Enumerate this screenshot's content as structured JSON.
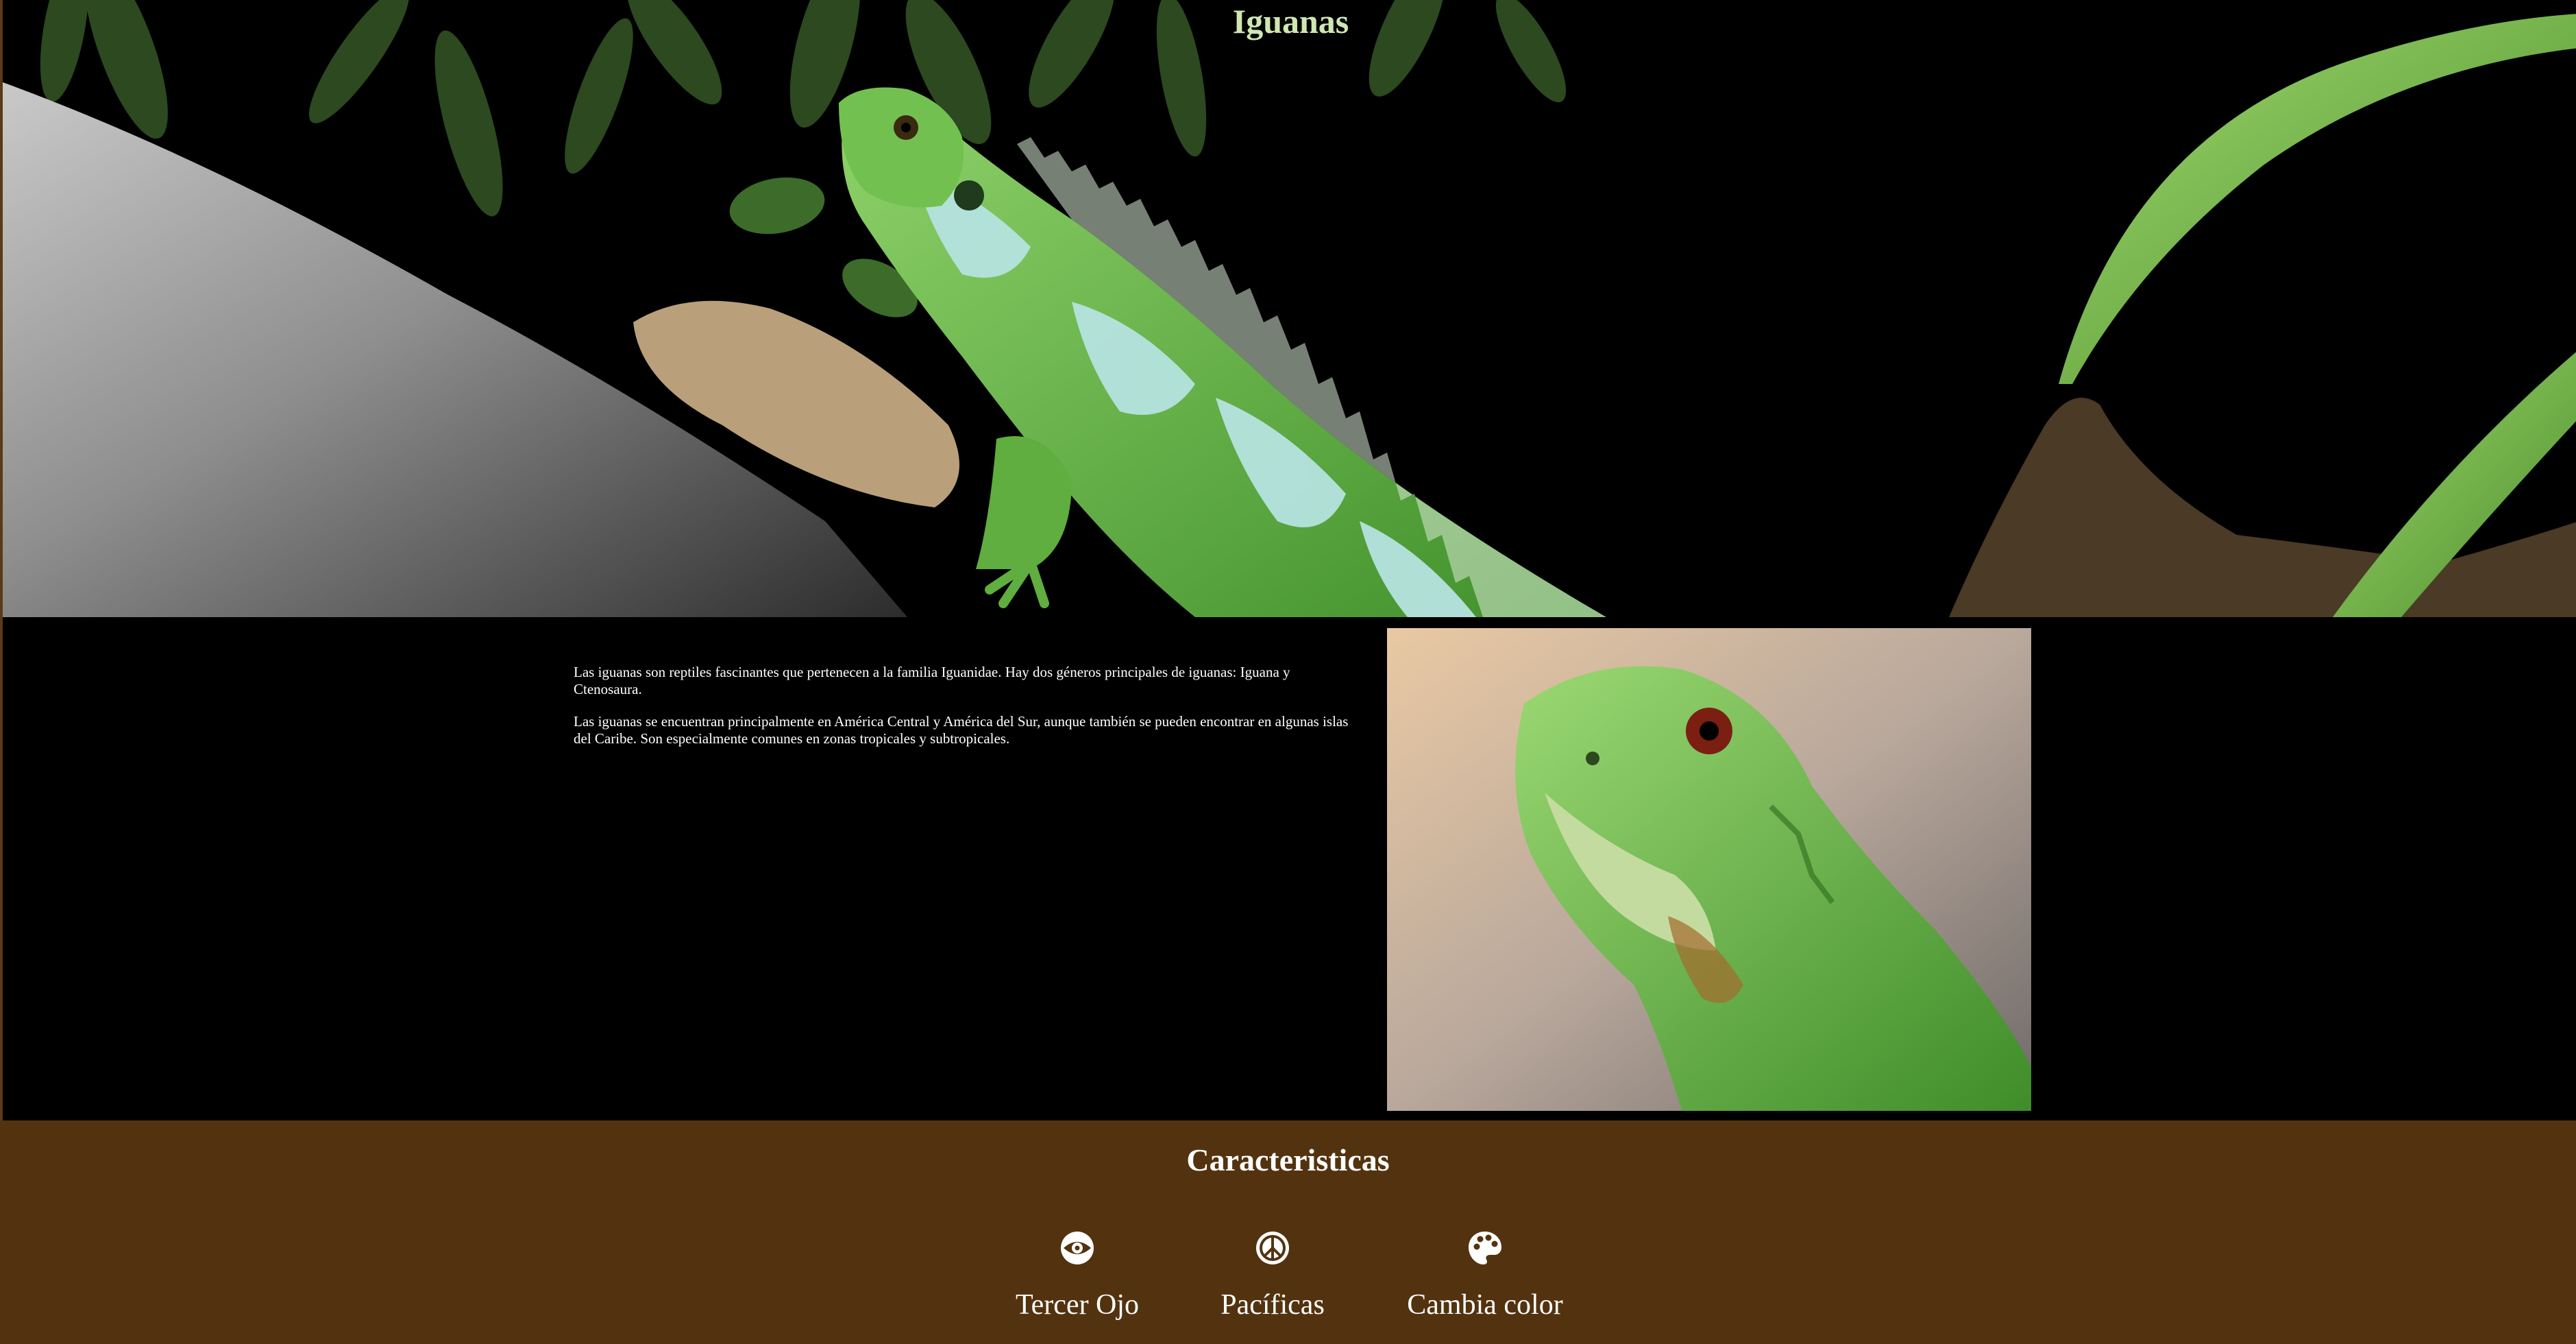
{
  "header": {
    "title": "Iguanas"
  },
  "intro": {
    "paragraphs": [
      "Las iguanas son reptiles fascinantes que pertenecen a la familia Iguanidae. Hay dos géneros principales de iguanas: Iguana y Ctenosaura.",
      "Las iguanas se encuentran principalmente en América Central y América del Sur, aunque también se pueden encontrar en algunas islas del Caribe. Son especialmente comunes en zonas tropicales y subtropicales."
    ]
  },
  "features": {
    "title": "Caracteristicas",
    "items": [
      {
        "icon": "eye-icon",
        "label": "Tercer Ojo"
      },
      {
        "icon": "peace-icon",
        "label": "Pacíficas"
      },
      {
        "icon": "palette-icon",
        "label": "Cambia color"
      }
    ]
  },
  "colors": {
    "features_background": "#53330f",
    "page_background": "#000000",
    "title_color": "#cfe7b0",
    "accent_border": "#5a3a17"
  }
}
